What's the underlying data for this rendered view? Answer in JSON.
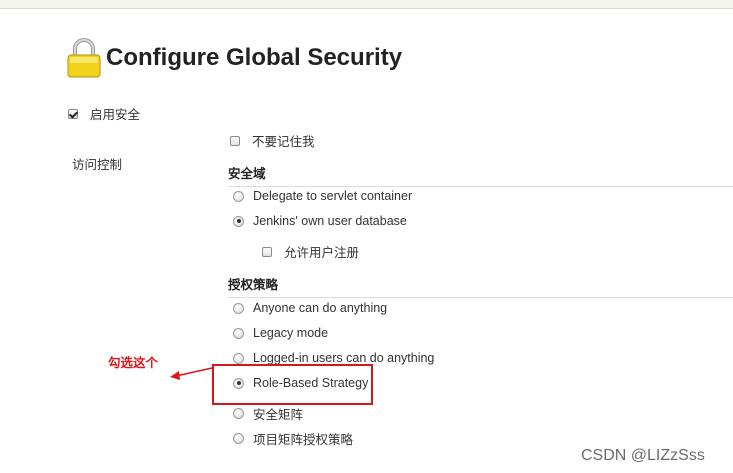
{
  "page": {
    "title": "Configure Global Security",
    "icon": "lock-icon"
  },
  "enable_security": {
    "label": "启用安全",
    "checked": true
  },
  "access_control": {
    "label": "访问控制"
  },
  "remember_me": {
    "label": "不要记住我",
    "checked": false
  },
  "security_realm": {
    "heading": "安全域",
    "options": [
      {
        "label": "Delegate to servlet container",
        "selected": false
      },
      {
        "label": "Jenkins' own user database",
        "selected": true
      }
    ],
    "allow_signup": {
      "label": "允许用户注册",
      "checked": false
    }
  },
  "authorization": {
    "heading": "授权策略",
    "options": [
      {
        "label": "Anyone can do anything",
        "selected": false
      },
      {
        "label": "Legacy mode",
        "selected": false
      },
      {
        "label": "Logged-in users can do anything",
        "selected": false
      },
      {
        "label": "Role-Based Strategy",
        "selected": true
      },
      {
        "label": "安全矩阵",
        "selected": false
      },
      {
        "label": "项目矩阵授权策略",
        "selected": false
      }
    ]
  },
  "annotation": {
    "text": "勾选这个",
    "color": "#e0161b"
  },
  "watermark": "CSDN @LIZzSss"
}
